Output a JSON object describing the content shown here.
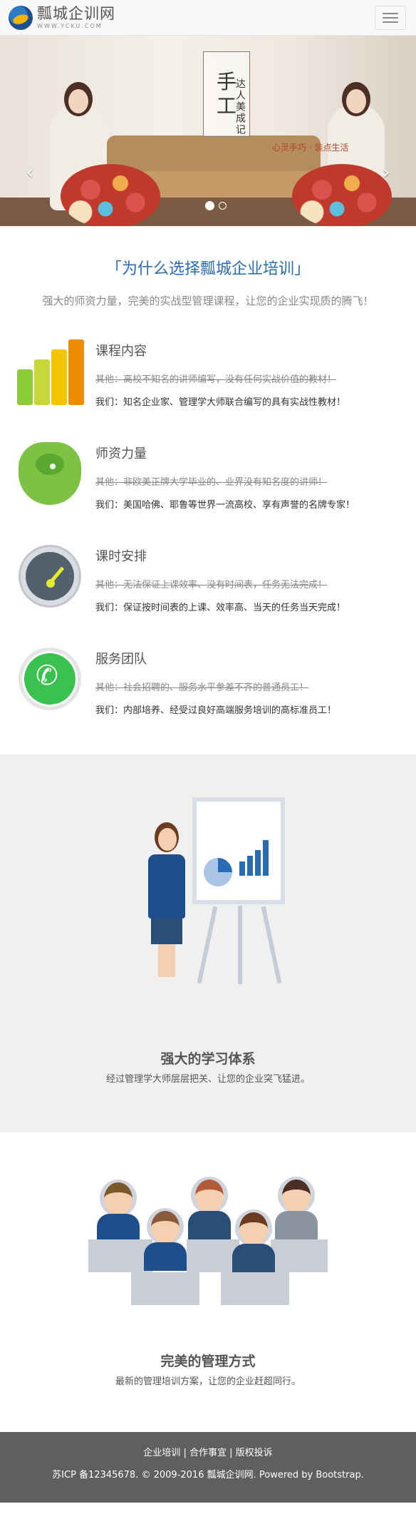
{
  "navbar": {
    "brand_name": "瓢城企训网",
    "brand_url": "WWW.YCKU.COM",
    "menu_button": "toggle navigation"
  },
  "carousel": {
    "slogan_main": [
      "手",
      "工"
    ],
    "slogan_side": "达人美成记",
    "slogan_sub": "心灵手巧 · 装点生活",
    "active_slide": 1,
    "slide_count": 2
  },
  "why": {
    "title": "「为什么选择瓢城企业培训」",
    "subtitle": "强大的师资力量，完美的实战型管理课程，让您的企业实现质的腾飞！",
    "features": [
      {
        "icon": "bar-chart-icon",
        "title": "课程内容",
        "other": "其他：高校不知名的讲师编写，没有任何实战价值的教材！",
        "us": "我们：知名企业家、管理学大师联合编写的具有实战性教材！"
      },
      {
        "icon": "elephant-icon",
        "title": "师资力量",
        "other": "其他：非欧美正牌大学毕业的、业界没有知名度的讲师！",
        "us": "我们：美国哈佛、耶鲁等世界一流高校、享有声誉的名牌专家！"
      },
      {
        "icon": "stopwatch-icon",
        "title": "课时安排",
        "other": "其他：无法保证上课效率、没有时间表，任务无法完成！",
        "us": "我们：保证按时间表的上课、效率高、当天的任务当天完成！"
      },
      {
        "icon": "phone-icon",
        "title": "服务团队",
        "other": "其他：社会招聘的、服务水平参差不齐的普通员工！",
        "us": "我们：内部培养、经受过良好高端服务培训的高标准员工！"
      }
    ]
  },
  "system": {
    "title": "强大的学习体系",
    "subtitle": "经过管理学大师层层把关、让您的企业突飞猛进。"
  },
  "manage": {
    "title": "完美的管理方式",
    "subtitle": "最新的管理培训方案，让您的企业赶超同行。"
  },
  "footer": {
    "links": [
      "企业培训",
      "合作事宜",
      "版权投诉"
    ],
    "separator": "|",
    "copyright": "苏ICP 备12345678. © 2009-2016 瓢城企训网. Powered by Bootstrap."
  },
  "colors": {
    "accent": "#2a6cb3",
    "footer_bg": "#5f5f5f",
    "section_bg": "#f0f0f0"
  }
}
